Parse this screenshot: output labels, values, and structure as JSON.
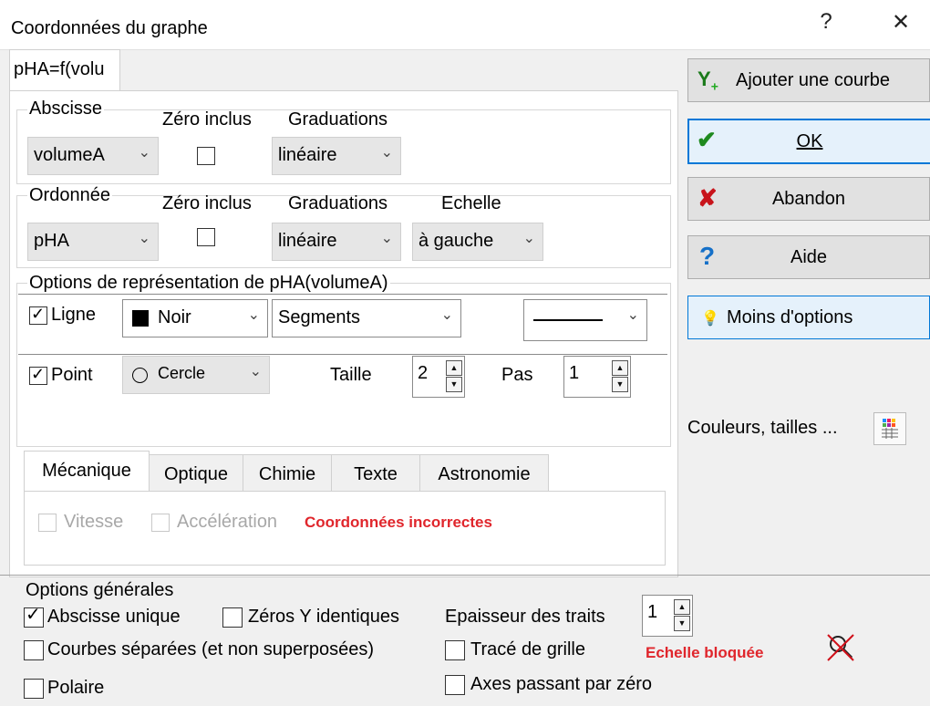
{
  "window": {
    "title": "Coordonnées du graphe",
    "help_glyph": "?",
    "close_glyph": "✕"
  },
  "tab": {
    "label": "pHA=f(volu"
  },
  "abscisse": {
    "label": "Abscisse",
    "zero_label": "Zéro inclus",
    "grad_label": "Graduations",
    "variable": "volumeA",
    "graduation": "linéaire",
    "zero_checked": false
  },
  "ordonnee": {
    "label": "Ordonnée",
    "zero_label": "Zéro inclus",
    "grad_label": "Graduations",
    "echelle_label": "Echelle",
    "variable": "pHA",
    "graduation": "linéaire",
    "echelle": "à gauche",
    "zero_checked": false
  },
  "options": {
    "label": "Options de représentation de pHA(volumeA)",
    "ligne": {
      "label": "Ligne",
      "checked": true,
      "color": "Noir",
      "color_hex": "#000000",
      "style": "Segments",
      "check_glyph": "✓"
    },
    "point": {
      "label": "Point",
      "checked": true,
      "shape": "Cercle",
      "taille_label": "Taille",
      "taille": "2",
      "pas_label": "Pas",
      "pas": "1",
      "check_glyph": "✓"
    }
  },
  "subtabs": [
    "Mécanique",
    "Optique",
    "Chimie",
    "Texte",
    "Astronomie"
  ],
  "mecanique": {
    "vitesse": "Vitesse",
    "acceleration": "Accélération",
    "error": "Coordonnées incorrectes",
    "error_color": "#e0262c"
  },
  "buttons": {
    "add_curve": "Ajouter une courbe",
    "ok": "OK",
    "abandon": "Abandon",
    "aide": "Aide",
    "moins": "Moins d'options"
  },
  "couleurs": {
    "label": "Couleurs, tailles ..."
  },
  "general": {
    "label": "Options générales",
    "abscisse_unique": "Abscisse unique",
    "zeros_y": "Zéros Y identiques",
    "epaisseur_label": "Epaisseur des traits",
    "epaisseur": "1",
    "courbes_separees": "Courbes séparées (et non superposées)",
    "trace_grille": "Tracé de grille",
    "echelle_bloquee": "Echelle bloquée",
    "polaire": "Polaire",
    "axes_zero": "Axes passant par zéro",
    "check_glyph": "✓"
  }
}
